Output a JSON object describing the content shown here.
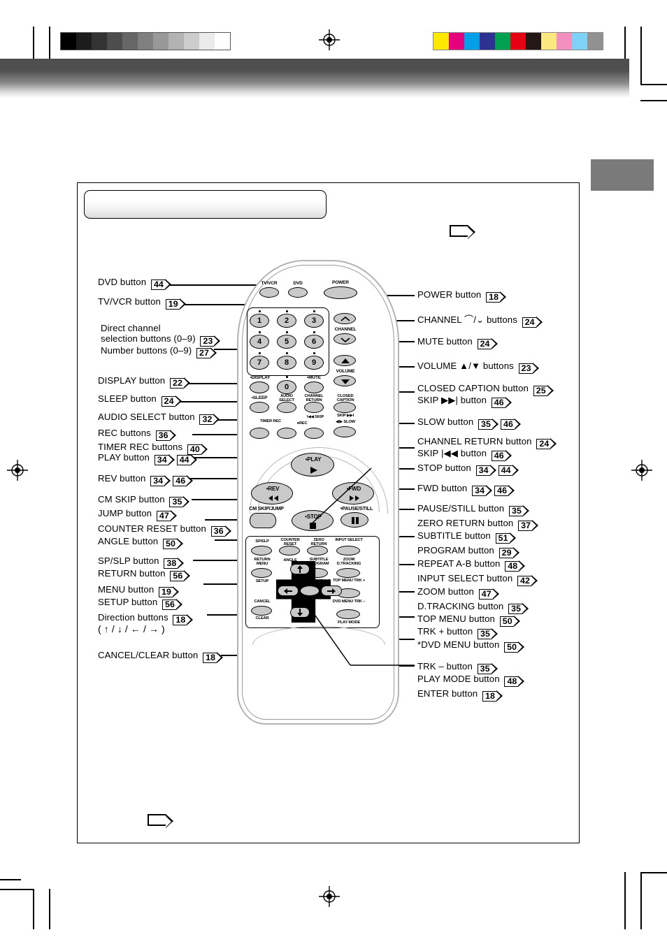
{
  "print_marks": {
    "grayscale_wedge": [
      "#000000",
      "#1c1c1c",
      "#333333",
      "#4d4d4d",
      "#666666",
      "#808080",
      "#999999",
      "#b3b3b3",
      "#cccccc",
      "#ebebeb",
      "#ffffff"
    ],
    "color_bar": [
      "#ffe800",
      "#e5007e",
      "#00a0e9",
      "#2e3192",
      "#00a051",
      "#e60012",
      "#231815",
      "#fbe87f",
      "#f490bf",
      "#7ed2f5",
      "#919191"
    ]
  },
  "page": {
    "title_bar_text": "",
    "top_page_badge": "",
    "bottom_page_badge": ""
  },
  "labels_left": [
    {
      "text": "DVD button",
      "refs": [
        "44"
      ]
    },
    {
      "text": "TV/VCR button",
      "refs": [
        "19"
      ]
    },
    {
      "text": "Direct channel",
      "refs": []
    },
    {
      "text": "selection buttons (0–9)",
      "refs": [
        "23"
      ]
    },
    {
      "text": "Number buttons (0–9)",
      "refs": [
        "27"
      ]
    },
    {
      "text": "DISPLAY button",
      "refs": [
        "22"
      ]
    },
    {
      "text": "SLEEP button",
      "refs": [
        "24"
      ]
    },
    {
      "text": "AUDIO SELECT button",
      "refs": [
        "32"
      ]
    },
    {
      "text": "REC buttons",
      "refs": [
        "36"
      ]
    },
    {
      "text": "TIMER REC buttons",
      "refs": [
        "40"
      ]
    },
    {
      "text": "PLAY button",
      "refs": [
        "34",
        "44"
      ]
    },
    {
      "text": "REV button",
      "refs": [
        "34",
        "46"
      ]
    },
    {
      "text": "CM SKIP button",
      "refs": [
        "35"
      ]
    },
    {
      "text": "JUMP button",
      "refs": [
        "47"
      ]
    },
    {
      "text": "COUNTER RESET button",
      "refs": [
        "36"
      ]
    },
    {
      "text": "ANGLE button",
      "refs": [
        "50"
      ]
    },
    {
      "text": "SP/SLP button",
      "refs": [
        "38"
      ]
    },
    {
      "text": "RETURN button",
      "refs": [
        "56"
      ]
    },
    {
      "text": "MENU button",
      "refs": [
        "19"
      ]
    },
    {
      "text": "SETUP button",
      "refs": [
        "56"
      ]
    },
    {
      "text": "Direction buttons",
      "refs": [
        "18"
      ]
    },
    {
      "text": "( ↑ / ↓ / ← / → )",
      "refs": []
    },
    {
      "text": "CANCEL/CLEAR button",
      "refs": [
        "18"
      ]
    }
  ],
  "labels_right": [
    {
      "text": "POWER button",
      "refs": [
        "18"
      ]
    },
    {
      "text": "CHANNEL ⌒/⌄ buttons",
      "refs": [
        "24"
      ]
    },
    {
      "text": "MUTE button",
      "refs": [
        "24"
      ]
    },
    {
      "text": "VOLUME ▲/▼ buttons",
      "refs": [
        "23"
      ]
    },
    {
      "text": "CLOSED CAPTION button",
      "refs": [
        "25"
      ]
    },
    {
      "text": "SKIP ▶▶| button",
      "refs": [
        "46"
      ]
    },
    {
      "text": "SLOW button",
      "refs": [
        "35",
        "46"
      ]
    },
    {
      "text": "CHANNEL RETURN button",
      "refs": [
        "24"
      ]
    },
    {
      "text": "SKIP |◀◀ button",
      "refs": [
        "46"
      ]
    },
    {
      "text": "STOP button",
      "refs": [
        "34",
        "44"
      ]
    },
    {
      "text": "FWD button",
      "refs": [
        "34",
        "46"
      ]
    },
    {
      "text": "PAUSE/STILL button",
      "refs": [
        "35"
      ]
    },
    {
      "text": "ZERO RETURN button",
      "refs": [
        "37"
      ]
    },
    {
      "text": "SUBTITLE button",
      "refs": [
        "51"
      ]
    },
    {
      "text": "PROGRAM button",
      "refs": [
        "29"
      ]
    },
    {
      "text": "REPEAT A-B button",
      "refs": [
        "48"
      ]
    },
    {
      "text": "INPUT SELECT button",
      "refs": [
        "42"
      ]
    },
    {
      "text": "ZOOM button",
      "refs": [
        "47"
      ]
    },
    {
      "text": "D.TRACKING button",
      "refs": [
        "35"
      ]
    },
    {
      "text": "TOP MENU button",
      "refs": [
        "50"
      ]
    },
    {
      "text": "TRK + button",
      "refs": [
        "35"
      ]
    },
    {
      "text": "*DVD MENU button",
      "refs": [
        "50"
      ]
    },
    {
      "text": "TRK – button",
      "refs": [
        "35"
      ]
    },
    {
      "text": "PLAY MODE button",
      "refs": [
        "48"
      ]
    },
    {
      "text": "ENTER button",
      "refs": [
        "18"
      ]
    }
  ],
  "remote": {
    "top_row": [
      "TV/VCR",
      "DVD",
      "POWER"
    ],
    "numbers": [
      "1",
      "2",
      "3",
      "4",
      "5",
      "6",
      "7",
      "8",
      "9",
      "0"
    ],
    "channel_label": "CHANNEL",
    "volume_label": "VOLUME",
    "fn_row": [
      "•DISPLAY",
      "•MUTE"
    ],
    "audio_select": "AUDIO SELECT",
    "sleep": "•SLEEP",
    "channel_return": "CHANNEL RETURN",
    "closed_caption": "CLOSED CAPTION",
    "skip_left": "I◀◀ SKIP",
    "skip_right": "SKIP ▶▶I",
    "slow": "◀I▶ SLOW",
    "timer_rec": "TIMER REC",
    "rec": "●REC",
    "play": "•PLAY",
    "rev": "•REV",
    "fwd": "•FWD",
    "stop": "•STOP",
    "pause_still": "•PAUSE/STILL",
    "cm_skip_jump": "CM SKIP/JUMP",
    "sp_slp": "SP/SLP",
    "counter_reset": "COUNTER RESET",
    "zero_return": "ZERO RETURN",
    "input_select": "INPUT SELECT",
    "return_menu": "RETURN MENU",
    "angle": "ANGLE",
    "subtitle_program": "SUBTITLE PROGRAM",
    "zoom_dtracking": "ZOOM D.TRACKING",
    "setup": "SETUP",
    "enter": "ENTER",
    "repeat_ab": "REPEAT A-B",
    "top_menu_trk_plus": "TOP MENU TRK +",
    "cancel": "CANCEL",
    "clear": "CLEAR",
    "dvd_menu_trk_minus": "DVD MENU TRK –",
    "play_mode": "PLAY MODE"
  }
}
